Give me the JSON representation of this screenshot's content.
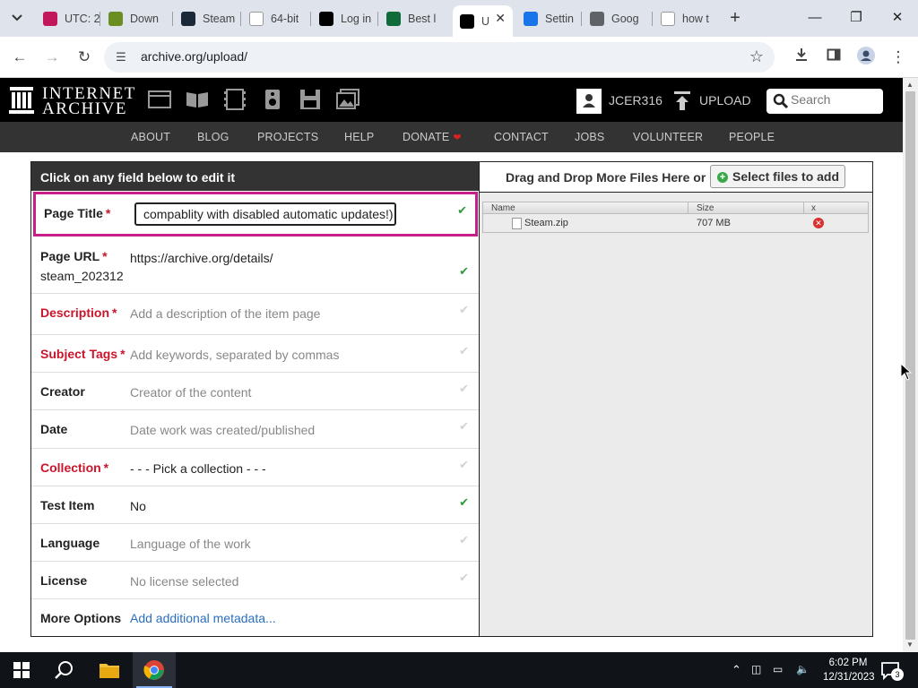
{
  "browser": {
    "tabs": [
      {
        "label": "UTC: 2",
        "favicon_color": "#c2185b"
      },
      {
        "label": "Down",
        "favicon_color": "#6b8e23"
      },
      {
        "label": "Steam",
        "favicon_color": "#1b2838"
      },
      {
        "label": "64-bit",
        "favicon_color": "#ffffff"
      },
      {
        "label": "Log in",
        "favicon_color": "#000000"
      },
      {
        "label": "Best l",
        "favicon_color": "#0f6b3a"
      },
      {
        "label": "U",
        "favicon_color": "#000000"
      },
      {
        "label": "Settin",
        "favicon_color": "#1a73e8"
      },
      {
        "label": "Goog",
        "favicon_color": "#5f6368"
      },
      {
        "label": "how t",
        "favicon_color": "#ffffff"
      }
    ],
    "active_tab_index": 6,
    "url": "archive.org/upload/"
  },
  "site": {
    "logo_line1": "INTERNET",
    "logo_line2": "ARCHIVE",
    "username": "JCER316",
    "upload_label": "UPLOAD",
    "search_placeholder": "Search",
    "nav": [
      "ABOUT",
      "BLOG",
      "PROJECTS",
      "HELP",
      "DONATE",
      "CONTACT",
      "JOBS",
      "VOLUNTEER",
      "PEOPLE"
    ]
  },
  "form": {
    "header": "Click on any field below to edit it",
    "page_title": {
      "label": "Page Title",
      "value": "compablity with disabled automatic updates!)"
    },
    "page_url": {
      "label": "Page URL",
      "value": "https://archive.org/details/",
      "slug": "steam_202312"
    },
    "rows": [
      {
        "label": "Description",
        "required": true,
        "value": "Add a description of the item page",
        "placeholder": true,
        "checked": false
      },
      {
        "label": "Subject Tags",
        "required": true,
        "value": "Add keywords, separated by commas",
        "placeholder": true,
        "checked": false
      },
      {
        "label": "Creator",
        "required": false,
        "value": "Creator of the content",
        "placeholder": true,
        "checked": false
      },
      {
        "label": "Date",
        "required": false,
        "value": "Date work was created/published",
        "placeholder": true,
        "checked": false
      },
      {
        "label": "Collection",
        "required": true,
        "value": "- - - Pick a collection - - -",
        "placeholder": false,
        "checked": false
      },
      {
        "label": "Test Item",
        "required": false,
        "value": "No",
        "placeholder": false,
        "checked": true
      },
      {
        "label": "Language",
        "required": false,
        "value": "Language of the work",
        "placeholder": true,
        "checked": false
      },
      {
        "label": "License",
        "required": false,
        "value": "No license selected",
        "placeholder": true,
        "checked": false
      }
    ],
    "more_options": {
      "label": "More Options",
      "link": "Add additional metadata..."
    }
  },
  "files": {
    "drop_text": "Drag and Drop More Files Here or",
    "select_button": "Select files to add",
    "columns": {
      "name": "Name",
      "size": "Size",
      "x": "x"
    },
    "items": [
      {
        "name": "Steam.zip",
        "size": "707 MB"
      }
    ]
  },
  "taskbar": {
    "time": "6:02 PM",
    "date": "12/31/2023",
    "notification_count": "3"
  }
}
